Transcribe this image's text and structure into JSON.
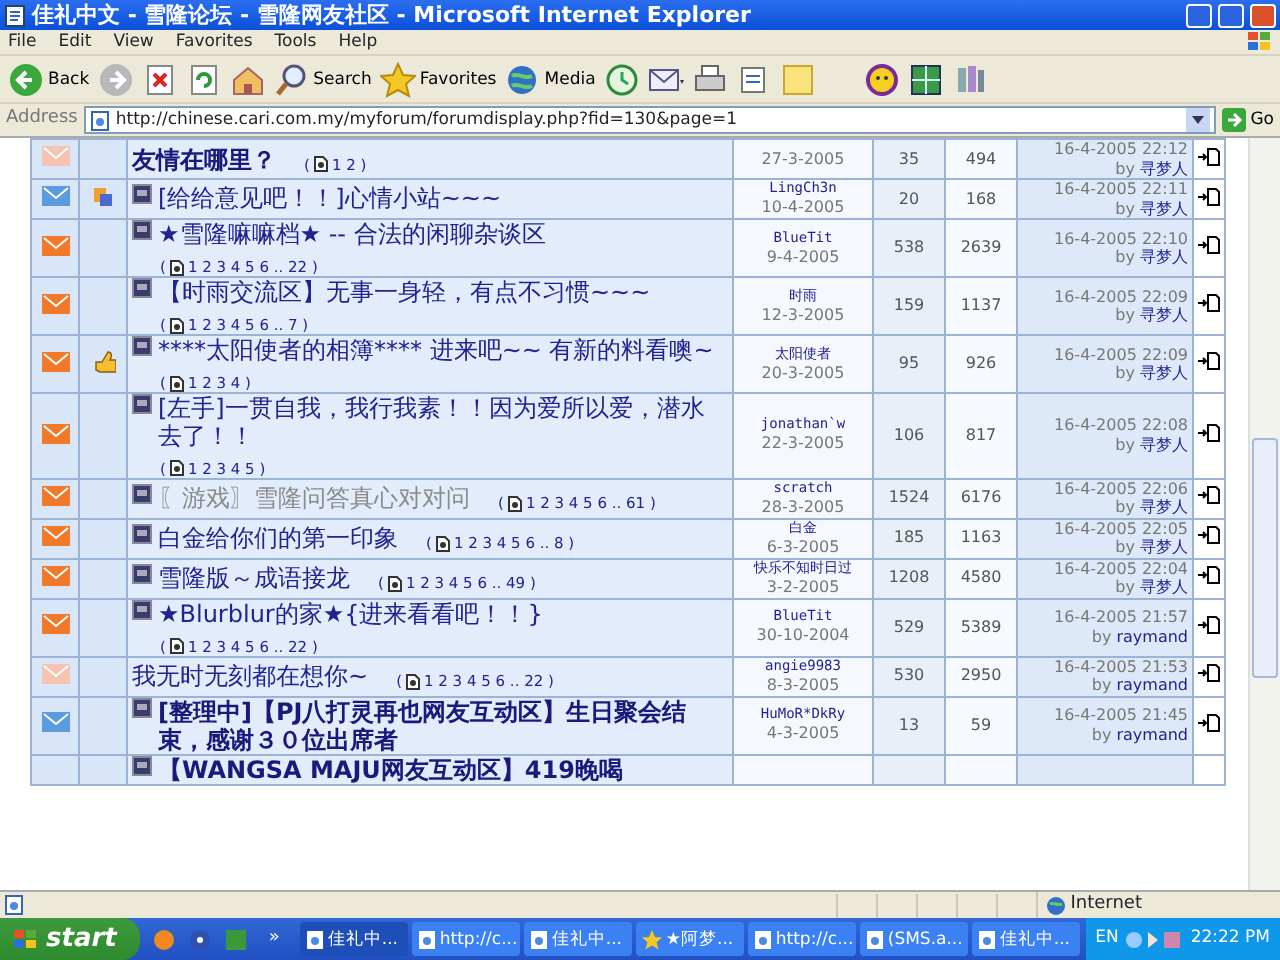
{
  "window": {
    "title": "佳礼中文 - 雪隆论坛 - 雪隆网友社区 - Microsoft Internet Explorer"
  },
  "menu": [
    "File",
    "Edit",
    "View",
    "Favorites",
    "Tools",
    "Help"
  ],
  "toolbar": [
    {
      "kind": "back",
      "label": "Back"
    },
    {
      "kind": "forward"
    },
    {
      "kind": "stop"
    },
    {
      "kind": "refresh"
    },
    {
      "kind": "home"
    },
    {
      "kind": "search",
      "label": "Search"
    },
    {
      "kind": "favorites",
      "label": "Favorites"
    },
    {
      "kind": "media",
      "label": "Media"
    },
    {
      "kind": "history"
    },
    {
      "kind": "mail"
    },
    {
      "kind": "print"
    },
    {
      "kind": "edit"
    },
    {
      "kind": "note"
    },
    {
      "kind": "messenger"
    },
    {
      "kind": "puzzle"
    },
    {
      "kind": "research"
    }
  ],
  "address": {
    "label": "Address",
    "url": "http://chinese.cari.com.my/myforum/forumdisplay.php?fid=130&page=1",
    "go": "Go"
  },
  "threads": [
    {
      "color": "#f5c3b2",
      "topic_icon": false,
      "title": {
        "kind": "bold",
        "text": "友情在哪里？"
      },
      "pages": [
        "(",
        "1 2 )"
      ],
      "date": "27-3-2005",
      "replies": "35",
      "views": "494",
      "last_date": "16-4-2005 22:12",
      "by": "by",
      "last_by": "寻梦人"
    },
    {
      "color": "#5b9be0",
      "badge": {
        "kind": "pages"
      },
      "topic_icon": true,
      "title": {
        "kind": "normal",
        "text": "[给给意见吧！！]心情小站~~~"
      },
      "author": "LingCh3n",
      "date": "10-4-2005",
      "replies": "20",
      "views": "168",
      "last_date": "16-4-2005 22:11",
      "by": "by",
      "last_by": "寻梦人"
    },
    {
      "color": "#f07a2a",
      "topic_icon": true,
      "title": {
        "kind": "normal",
        "text": "★雪隆嘛嘛档★ -- 合法的闲聊杂谈区"
      },
      "pages": [
        "(",
        "1 2 3 4 5 6 .. 22 )"
      ],
      "author": "BlueTit",
      "date": "9-4-2005",
      "replies": "538",
      "views": "2639",
      "last_date": "16-4-2005 22:10",
      "by": "by",
      "last_by": "寻梦人"
    },
    {
      "color": "#f07a2a",
      "topic_icon": true,
      "title": {
        "kind": "normal",
        "text": "【时雨交流区】无事一身轻，有点不习惯~~~"
      },
      "pages": [
        "(",
        "1 2 3 4 5 6 .. 7 )"
      ],
      "author": "时雨",
      "date": "12-3-2005",
      "replies": "159",
      "views": "1137",
      "last_date": "16-4-2005 22:09",
      "by": "by",
      "last_by": "寻梦人"
    },
    {
      "color": "#f07a2a",
      "badge": {
        "kind": "thumb"
      },
      "topic_icon": true,
      "title": {
        "kind": "normal",
        "text": "****太阳使者的相簿**** 进来吧~~ 有新的料看噢~"
      },
      "pages": [
        "(",
        "1 2 3 4 )"
      ],
      "author": "太阳使者",
      "date": "20-3-2005",
      "replies": "95",
      "views": "926",
      "last_date": "16-4-2005 22:09",
      "by": "by",
      "last_by": "寻梦人"
    },
    {
      "color": "#f07a2a",
      "topic_icon": true,
      "title": {
        "kind": "normal",
        "text": "[左手]一贯自我，我行我素！！因为爱所以爱，潜水去了！！"
      },
      "pages": [
        "(",
        "1 2 3 4 5 )"
      ],
      "author": "jonathan`w",
      "date": "22-3-2005",
      "replies": "106",
      "views": "817",
      "last_date": "16-4-2005 22:08",
      "by": "by",
      "last_by": "寻梦人"
    },
    {
      "color": "#f07a2a",
      "topic_icon": true,
      "title": {
        "kind": "muted",
        "text": "〖游戏〗雪隆问答真心对对问"
      },
      "pages": [
        "(",
        "1 2 3 4 5 6 .. 61 )"
      ],
      "author": "scratch",
      "date": "28-3-2005",
      "replies": "1524",
      "views": "6176",
      "last_date": "16-4-2005 22:06",
      "by": "by",
      "last_by": "寻梦人"
    },
    {
      "color": "#f07a2a",
      "topic_icon": true,
      "title": {
        "kind": "normal",
        "text": "白金给你们的第一印象"
      },
      "pages": [
        "(",
        "1 2 3 4 5 6 .. 8 )"
      ],
      "author": "白金",
      "date": "6-3-2005",
      "replies": "185",
      "views": "1163",
      "last_date": "16-4-2005 22:05",
      "by": "by",
      "last_by": "寻梦人"
    },
    {
      "color": "#f07a2a",
      "topic_icon": true,
      "title": {
        "kind": "normal",
        "text": "雪隆版～成语接龙"
      },
      "pages": [
        "(",
        "1 2 3 4 5 6 .. 49 )"
      ],
      "author": "快乐不知时日过",
      "date": "3-2-2005",
      "replies": "1208",
      "views": "4580",
      "last_date": "16-4-2005 22:04",
      "by": "by",
      "last_by": "寻梦人"
    },
    {
      "color": "#f07a2a",
      "topic_icon": true,
      "title": {
        "kind": "normal",
        "text": "★Blurblur的家★{进来看看吧！！}"
      },
      "pages": [
        "(",
        "1 2 3 4 5 6 .. 22 )"
      ],
      "author": "BlueTit",
      "date": "30-10-2004",
      "replies": "529",
      "views": "5389",
      "last_date": "16-4-2005 21:57",
      "by": "by",
      "last_by": "raymand"
    },
    {
      "color": "#f5c3b2",
      "topic_icon": false,
      "title": {
        "kind": "normal",
        "text": "我无时无刻都在想你~"
      },
      "pages": [
        "(",
        "1 2 3 4 5 6 .. 22 )"
      ],
      "author": "angie9983",
      "date": "8-3-2005",
      "replies": "530",
      "views": "2950",
      "last_date": "16-4-2005 21:53",
      "by": "by",
      "last_by": "raymand"
    },
    {
      "color": "#5b9be0",
      "topic_icon": true,
      "title": {
        "kind": "bold",
        "text": "[整理中]【PJ八打灵再也网友互动区】生日聚会结束，感谢３０位出席者"
      },
      "author": "HuMoR*DkRy",
      "date": "4-3-2005",
      "replies": "13",
      "views": "59",
      "last_date": "16-4-2005 21:45",
      "by": "by",
      "last_by": "raymand"
    },
    {
      "topic_icon": true,
      "title": {
        "kind": "bold",
        "text": "【WANGSA MAJU网友互动区】419晚喝"
      }
    }
  ],
  "status_bar": {
    "zone": "Internet"
  },
  "taskbar": {
    "start": "start",
    "quick_launch": [
      {
        "kind": "browser"
      },
      {
        "kind": "media"
      },
      {
        "kind": "app"
      }
    ],
    "more": "»",
    "tasks": [
      {
        "label": "佳礼中...",
        "kind": "page",
        "selected": true
      },
      {
        "label": "http://c...",
        "kind": "page",
        "selected": false
      },
      {
        "label": "佳礼中...",
        "kind": "page",
        "selected": false
      },
      {
        "label": "★阿梦...",
        "kind": "chat",
        "selected": false
      },
      {
        "label": "http://c...",
        "kind": "page",
        "selected": false
      },
      {
        "label": "(SMS.a...",
        "kind": "page",
        "selected": false
      },
      {
        "label": "佳礼中...",
        "kind": "page",
        "selected": false
      }
    ],
    "language": "EN",
    "clock": "22:22 PM"
  }
}
